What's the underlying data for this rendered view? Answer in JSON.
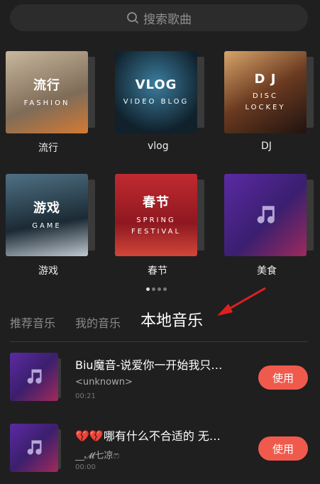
{
  "search": {
    "placeholder": "搜索歌曲"
  },
  "categories": [
    {
      "label": "流行",
      "thumb_title": "流行",
      "thumb_sub": "FASHION",
      "bg": "#9a8a78"
    },
    {
      "label": "vlog",
      "thumb_title": "VLOG",
      "thumb_sub": "VIDEO BLOG",
      "bg": "#26495e"
    },
    {
      "label": "DJ",
      "thumb_title": "D J",
      "thumb_sub": "DISC\nLOCKEY",
      "bg": "#7a4a2a"
    },
    {
      "label": "游戏",
      "thumb_title": "游戏",
      "thumb_sub": "GAME",
      "bg": "#2d4250"
    },
    {
      "label": "春节",
      "thumb_title": "春节",
      "thumb_sub": "SPRING\nFESTIVAL",
      "bg": "#b3232b"
    },
    {
      "label": "美食",
      "thumb_title": "",
      "thumb_sub": "",
      "bg": "#4a2a8a"
    }
  ],
  "tabs": [
    {
      "label": "推荐音乐"
    },
    {
      "label": "我的音乐"
    },
    {
      "label": "本地音乐"
    }
  ],
  "songs": [
    {
      "title": "Biu魔音-说爱你一开始我只…",
      "artist": "<unknown>",
      "duration": "00:21",
      "button": "使用"
    },
    {
      "title": "💔💔哪有什么不合适的 无…",
      "artist": "__𝓜七凉ෆ",
      "duration": "00:00",
      "button": "使用"
    }
  ],
  "colors": {
    "accent": "#f05a4d",
    "background": "#1f1f1f"
  }
}
